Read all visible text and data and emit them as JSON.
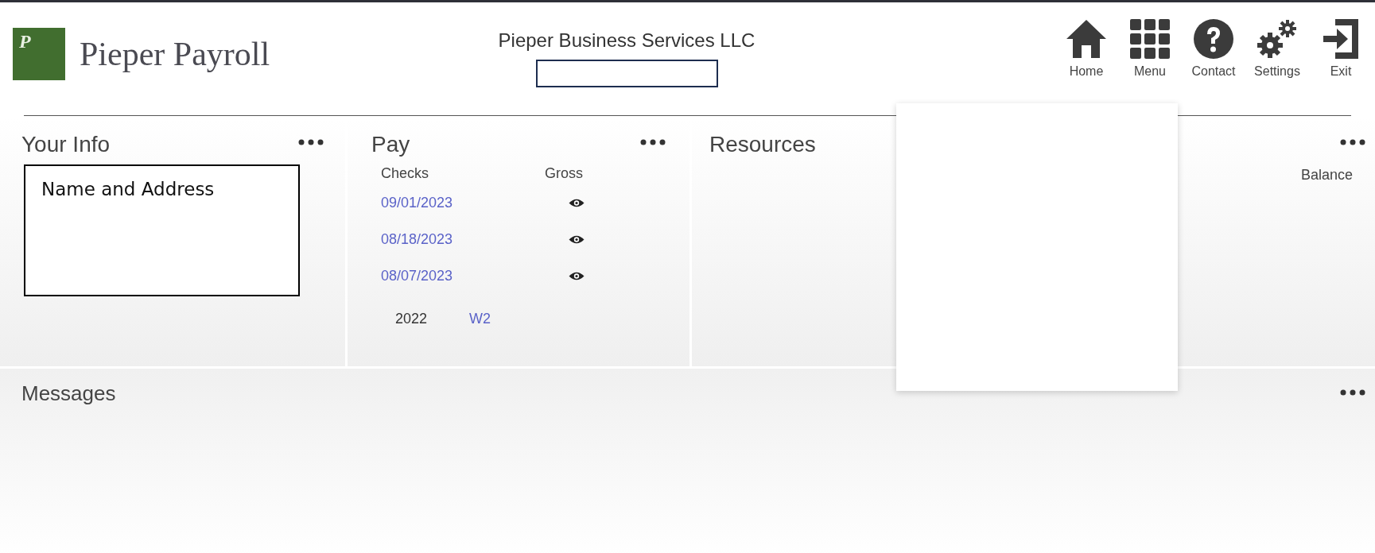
{
  "header": {
    "logo_letter": "P",
    "brand": "Pieper Payroll",
    "company": "Pieper Business Services LLC",
    "nav": [
      {
        "label": "Home"
      },
      {
        "label": "Menu"
      },
      {
        "label": "Contact"
      },
      {
        "label": "Settings"
      },
      {
        "label": "Exit"
      }
    ]
  },
  "your_info": {
    "title": "Your Info",
    "note": "Name and Address"
  },
  "pay": {
    "title": "Pay",
    "columns": [
      "Checks",
      "Gross"
    ],
    "checks": [
      {
        "date": "09/01/2023"
      },
      {
        "date": "08/18/2023"
      },
      {
        "date": "08/07/2023"
      }
    ],
    "w2": {
      "year": "2022",
      "link": "W2"
    }
  },
  "resources": {
    "title": "Resources",
    "column": "Balance"
  },
  "messages": {
    "title": "Messages"
  }
}
